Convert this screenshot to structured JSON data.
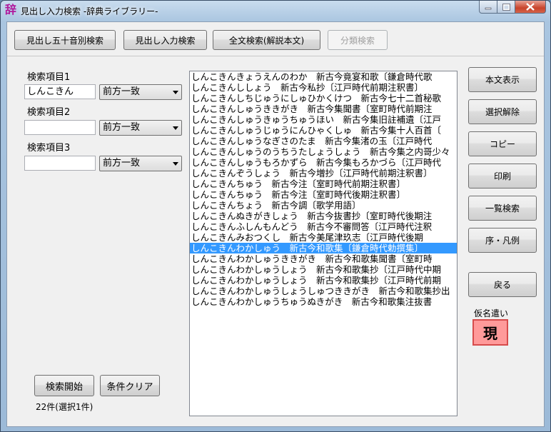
{
  "window": {
    "title": "見出し入力検索 -辞典ライブラリー-",
    "app_icon": "辞"
  },
  "toolbar": {
    "gojuon_label": "見出し五十音別検索",
    "input_label": "見出し入力検索",
    "fulltext_label": "全文検索(解説本文)",
    "category_label": "分類検索"
  },
  "search": {
    "field1_label": "検索項目1",
    "field1_value": "しんこきん",
    "field1_mode": "前方一致",
    "field2_label": "検索項目2",
    "field2_value": "",
    "field2_mode": "前方一致",
    "field3_label": "検索項目3",
    "field3_value": "",
    "field3_mode": "前方一致",
    "start_label": "検索開始",
    "clear_label": "条件クリア",
    "status": "22件(選択1件)"
  },
  "results": {
    "selected_index": 16,
    "items": [
      "しんこきんきょうえんのわか　新古今竟宴和歌〔鎌倉時代歌",
      "しんこきんししょう　新古今私抄〔江戸時代前期注釈書〕",
      "しんこきんしちじゅうにしゅひかくけつ　新古今七十二首秘歌",
      "しんこきんしゅうききがき　新古今集聞書〔室町時代前期注",
      "しんこきんしゅうきゅうちゅうほい　新古今集旧註補遺〔江戸",
      "しんこきんしゅうじゅうにんひゃくしゅ　新古今集十人百首〔",
      "しんこきんしゅうなぎさのたま　新古今集渚の玉〔江戸時代",
      "しんこきんしゅうのうちうたしょうしょう　新古今集之内哥少々",
      "しんこきんしゅうもろかずら　新古今集もろかづら〔江戸時代",
      "しんこきんぞうしょう　新古今増抄〔江戸時代前期注釈書〕",
      "しんこきんちゅう　新古今注〔室町時代前期注釈書〕",
      "しんこきんちゅう　新古今注〔室町時代後期注釈書〕",
      "しんこきんちょう　新古今調〔歌学用語〕",
      "しんこきんぬきがきしょう　新古今抜書抄〔室町時代後期注",
      "しんこきんふしんもんどう　新古今不審問答〔江戸時代注釈",
      "しんこきんみおつくし　新古今美尾津玖志〔江戸時代後期",
      "しんこきんわかしゅう　新古今和歌集〔鎌倉時代勅撰集〕",
      "しんこきんわかしゅうききがき　新古今和歌集聞書〔室町時",
      "しんこきんわかしゅうしょう　新古今和歌集抄〔江戸時代中期",
      "しんこきんわかしゅうしょう　新古今和歌集抄〔江戸時代前期",
      "しんこきんわかしゅうしょうしゅつききがき　新古今和歌集抄出",
      "しんこきんわかしゅうちゅうぬきがき　新古今和歌集注抜書"
    ]
  },
  "actions": {
    "text_view": "本文表示",
    "deselect": "選択解除",
    "copy": "コピー",
    "print": "印刷",
    "list_search": "一覧検索",
    "preface": "序・凡例",
    "back": "戻る"
  },
  "kana": {
    "label": "仮名遣い",
    "value": "現"
  },
  "colors": {
    "selection": "#3399ff",
    "kana_box": "#ff9a9a"
  }
}
